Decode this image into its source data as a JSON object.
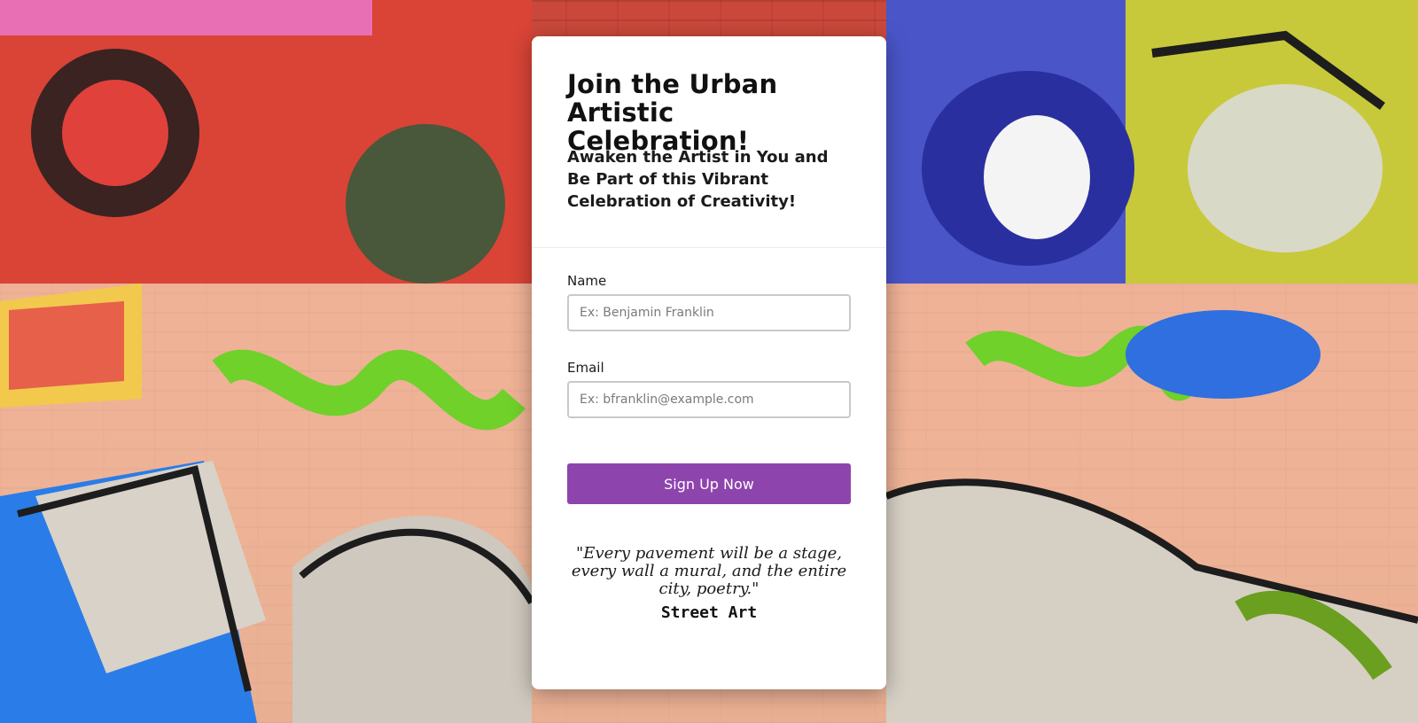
{
  "background": {
    "description_icon": "graffiti-wall-image"
  },
  "signup": {
    "title": "Join the Urban Artistic Celebration!",
    "subtitle": "Awaken the Artist in You and Be Part of this Vibrant Celebration of Creativity!",
    "name_label": "Name",
    "name_placeholder": "Ex: Benjamin Franklin",
    "email_label": "Email",
    "email_placeholder": "Ex: bfranklin@example.com",
    "submit_label": "Sign Up Now",
    "quote": "\"Every pavement will be a stage, every wall a mural, and the entire city, poetry.\"",
    "quote_source": "Street Art"
  },
  "colors": {
    "accent": "#8e44ad",
    "card_bg": "#ffffff"
  }
}
